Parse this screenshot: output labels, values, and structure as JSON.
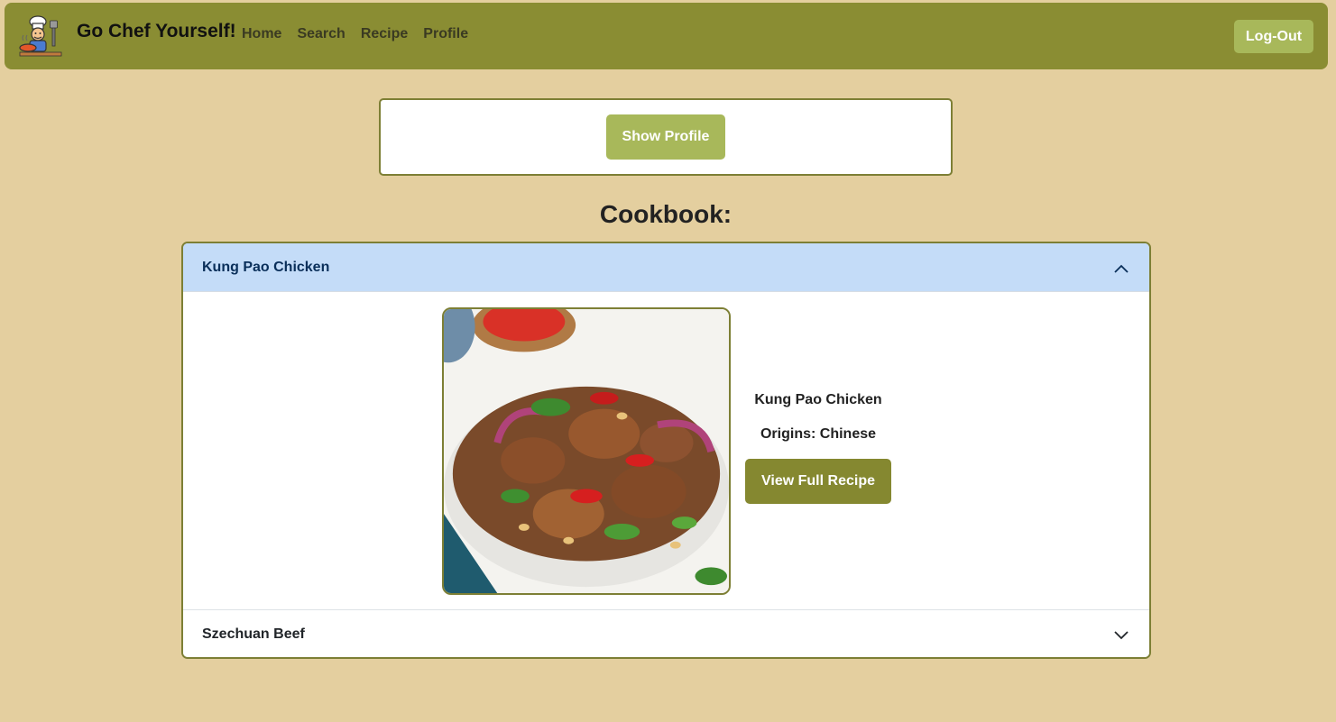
{
  "navbar": {
    "brand": "Go Chef Yourself!",
    "links": [
      "Home",
      "Search",
      "Recipe",
      "Profile"
    ],
    "logout_label": "Log-Out",
    "logo_icon": "chef-cooking-icon"
  },
  "profile": {
    "show_profile_label": "Show Profile"
  },
  "cookbook": {
    "title": "Cookbook:",
    "items": [
      {
        "name": "Kung Pao Chicken",
        "expanded": true,
        "origin_text": "Origins: Chinese",
        "view_label": "View Full Recipe"
      },
      {
        "name": "Szechuan Beef",
        "expanded": false
      }
    ]
  },
  "colors": {
    "background": "#e4cf9f",
    "navbar": "#8a8d33",
    "button_light": "#a8b85a",
    "button_dark": "#858830",
    "accordion_active": "#c4dcf8"
  }
}
